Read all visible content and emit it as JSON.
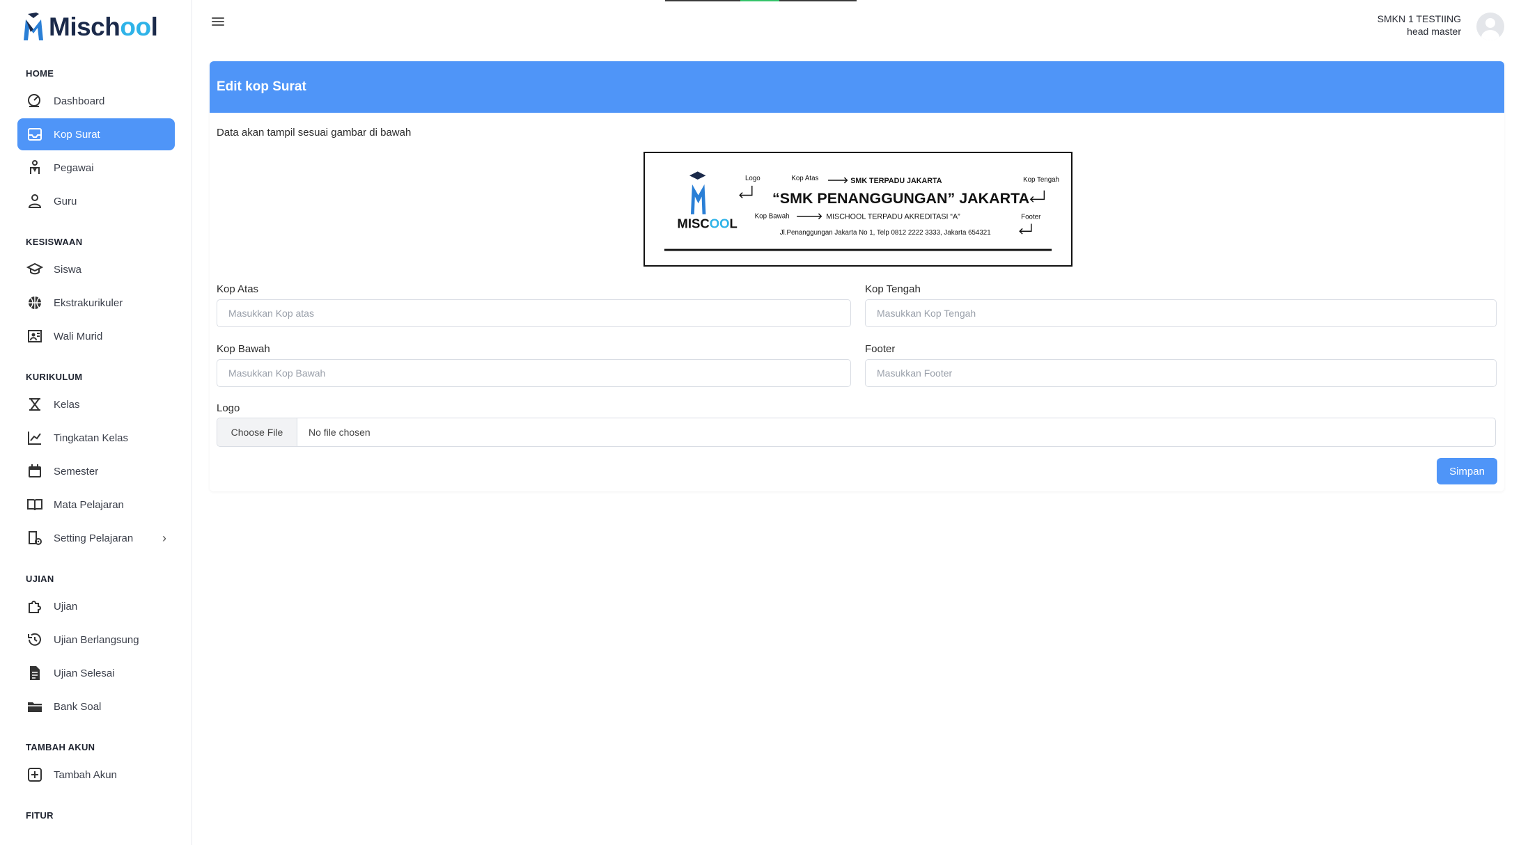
{
  "brand": {
    "name_prefix": "Misch",
    "name_suffix": "l",
    "oo": "oo"
  },
  "header": {
    "user_name": "SMKN 1 TESTIING",
    "user_role": "head master"
  },
  "sidebar": {
    "sections": [
      {
        "title": "HOME",
        "items": [
          {
            "label": "Dashboard",
            "icon": "dashboard-icon"
          },
          {
            "label": "Kop Surat",
            "icon": "inbox-icon",
            "active": true
          },
          {
            "label": "Pegawai",
            "icon": "employee-icon"
          },
          {
            "label": "Guru",
            "icon": "teacher-icon"
          }
        ]
      },
      {
        "title": "KESISWAAN",
        "items": [
          {
            "label": "Siswa",
            "icon": "graduation-cap-icon"
          },
          {
            "label": "Ekstrakurikuler",
            "icon": "basketball-icon"
          },
          {
            "label": "Wali Murid",
            "icon": "parent-icon"
          }
        ]
      },
      {
        "title": "KURIKULUM",
        "items": [
          {
            "label": "Kelas",
            "icon": "class-icon"
          },
          {
            "label": "Tingkatan Kelas",
            "icon": "chart-up-icon"
          },
          {
            "label": "Semester",
            "icon": "calendar-icon"
          },
          {
            "label": "Mata Pelajaran",
            "icon": "book-icon"
          },
          {
            "label": "Setting Pelajaran",
            "icon": "settings-doc-icon",
            "chevron": "›"
          }
        ]
      },
      {
        "title": "UJIAN",
        "items": [
          {
            "label": "Ujian",
            "icon": "puzzle-icon"
          },
          {
            "label": "Ujian Berlangsung",
            "icon": "history-icon"
          },
          {
            "label": "Ujian Selesai",
            "icon": "document-icon"
          },
          {
            "label": "Bank Soal",
            "icon": "folder-icon"
          }
        ]
      },
      {
        "title": "TAMBAH AKUN",
        "items": [
          {
            "label": "Tambah Akun",
            "icon": "plus-box-icon"
          }
        ]
      },
      {
        "title": "FITUR",
        "items": []
      }
    ]
  },
  "card": {
    "title": "Edit kop Surat",
    "helper": "Data akan tampil sesuai gambar di bawah"
  },
  "preview": {
    "logo_text": "MISC",
    "logo_oo": "OO",
    "logo_end": "L",
    "label_logo": "Logo",
    "label_kop_atas": "Kop Atas",
    "label_kop_tengah": "Kop Tengah",
    "label_kop_bawah": "Kop Bawah",
    "label_footer": "Footer",
    "kop_atas": "SMK TERPADU JAKARTA",
    "kop_tengah": "“SMK PENANGGUNGAN” JAKARTA",
    "kop_bawah": "MISCHOOL TERPADU AKREDITASI “A”",
    "footer": "Jl.Penanggungan Jakarta No 1, Telp 0812 2222 3333, Jakarta 654321"
  },
  "form": {
    "kop_atas": {
      "label": "Kop Atas",
      "placeholder": "Masukkan Kop atas",
      "value": ""
    },
    "kop_tengah": {
      "label": "Kop Tengah",
      "placeholder": "Masukkan Kop Tengah",
      "value": ""
    },
    "kop_bawah": {
      "label": "Kop Bawah",
      "placeholder": "Masukkan Kop Bawah",
      "value": ""
    },
    "footer": {
      "label": "Footer",
      "placeholder": "Masukkan Footer",
      "value": ""
    },
    "logo": {
      "label": "Logo",
      "button": "Choose File",
      "status": "No file chosen"
    },
    "submit": "Simpan"
  },
  "colors": {
    "accent": "#4f95f8",
    "brand_dark": "#1b2a4a",
    "brand_light": "#2fb3e8"
  }
}
